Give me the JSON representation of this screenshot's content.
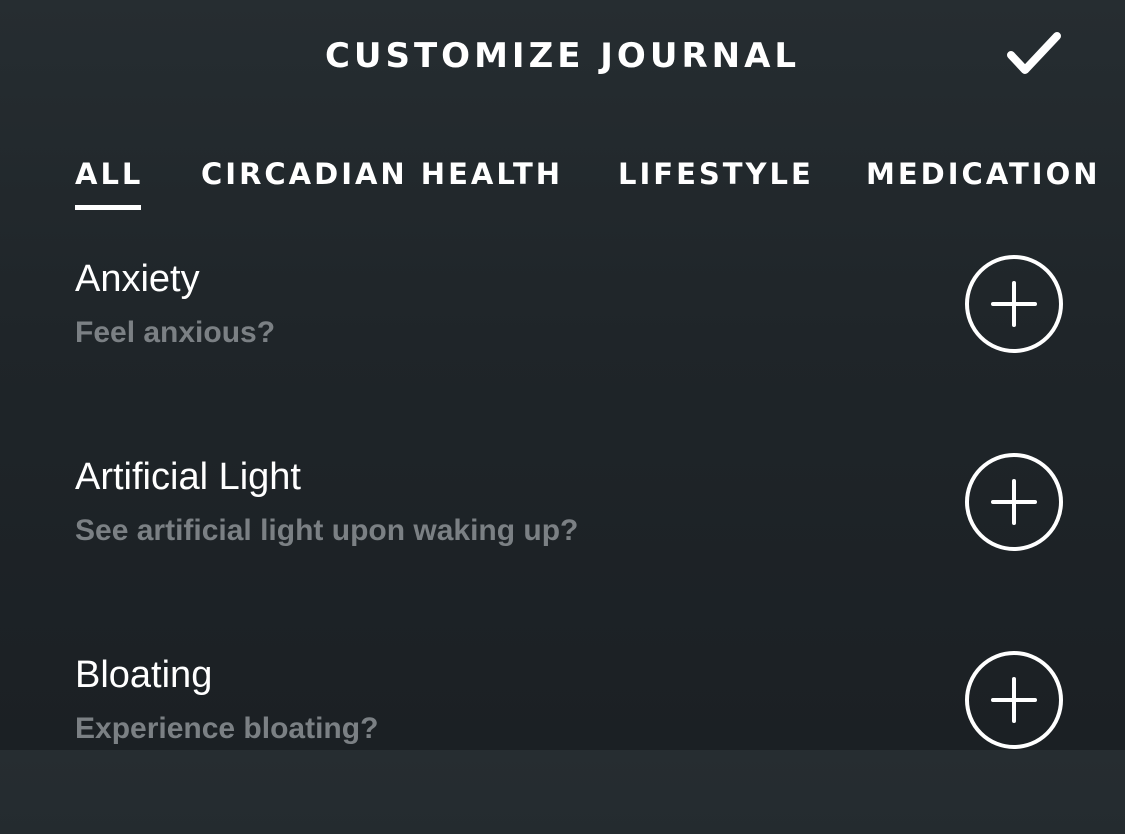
{
  "header": {
    "title": "CUSTOMIZE JOURNAL",
    "done_icon": "checkmark-icon"
  },
  "tabs": [
    {
      "label": "ALL",
      "selected": true
    },
    {
      "label": "CIRCADIAN HEALTH",
      "selected": false
    },
    {
      "label": "LIFESTYLE",
      "selected": false
    },
    {
      "label": "MEDICATION",
      "selected": false
    }
  ],
  "items": [
    {
      "title": "Anxiety",
      "subtitle": "Feel anxious?",
      "action_icon": "plus-circle-icon"
    },
    {
      "title": "Artificial Light",
      "subtitle": "See artificial light upon waking up?",
      "action_icon": "plus-circle-icon"
    },
    {
      "title": "Bloating",
      "subtitle": "Experience bloating?",
      "action_icon": "plus-circle-icon"
    }
  ],
  "colors": {
    "background_top": "#262d31",
    "background_bottom": "#1b2024",
    "text_primary": "#ffffff",
    "text_secondary": "#7b8084"
  }
}
